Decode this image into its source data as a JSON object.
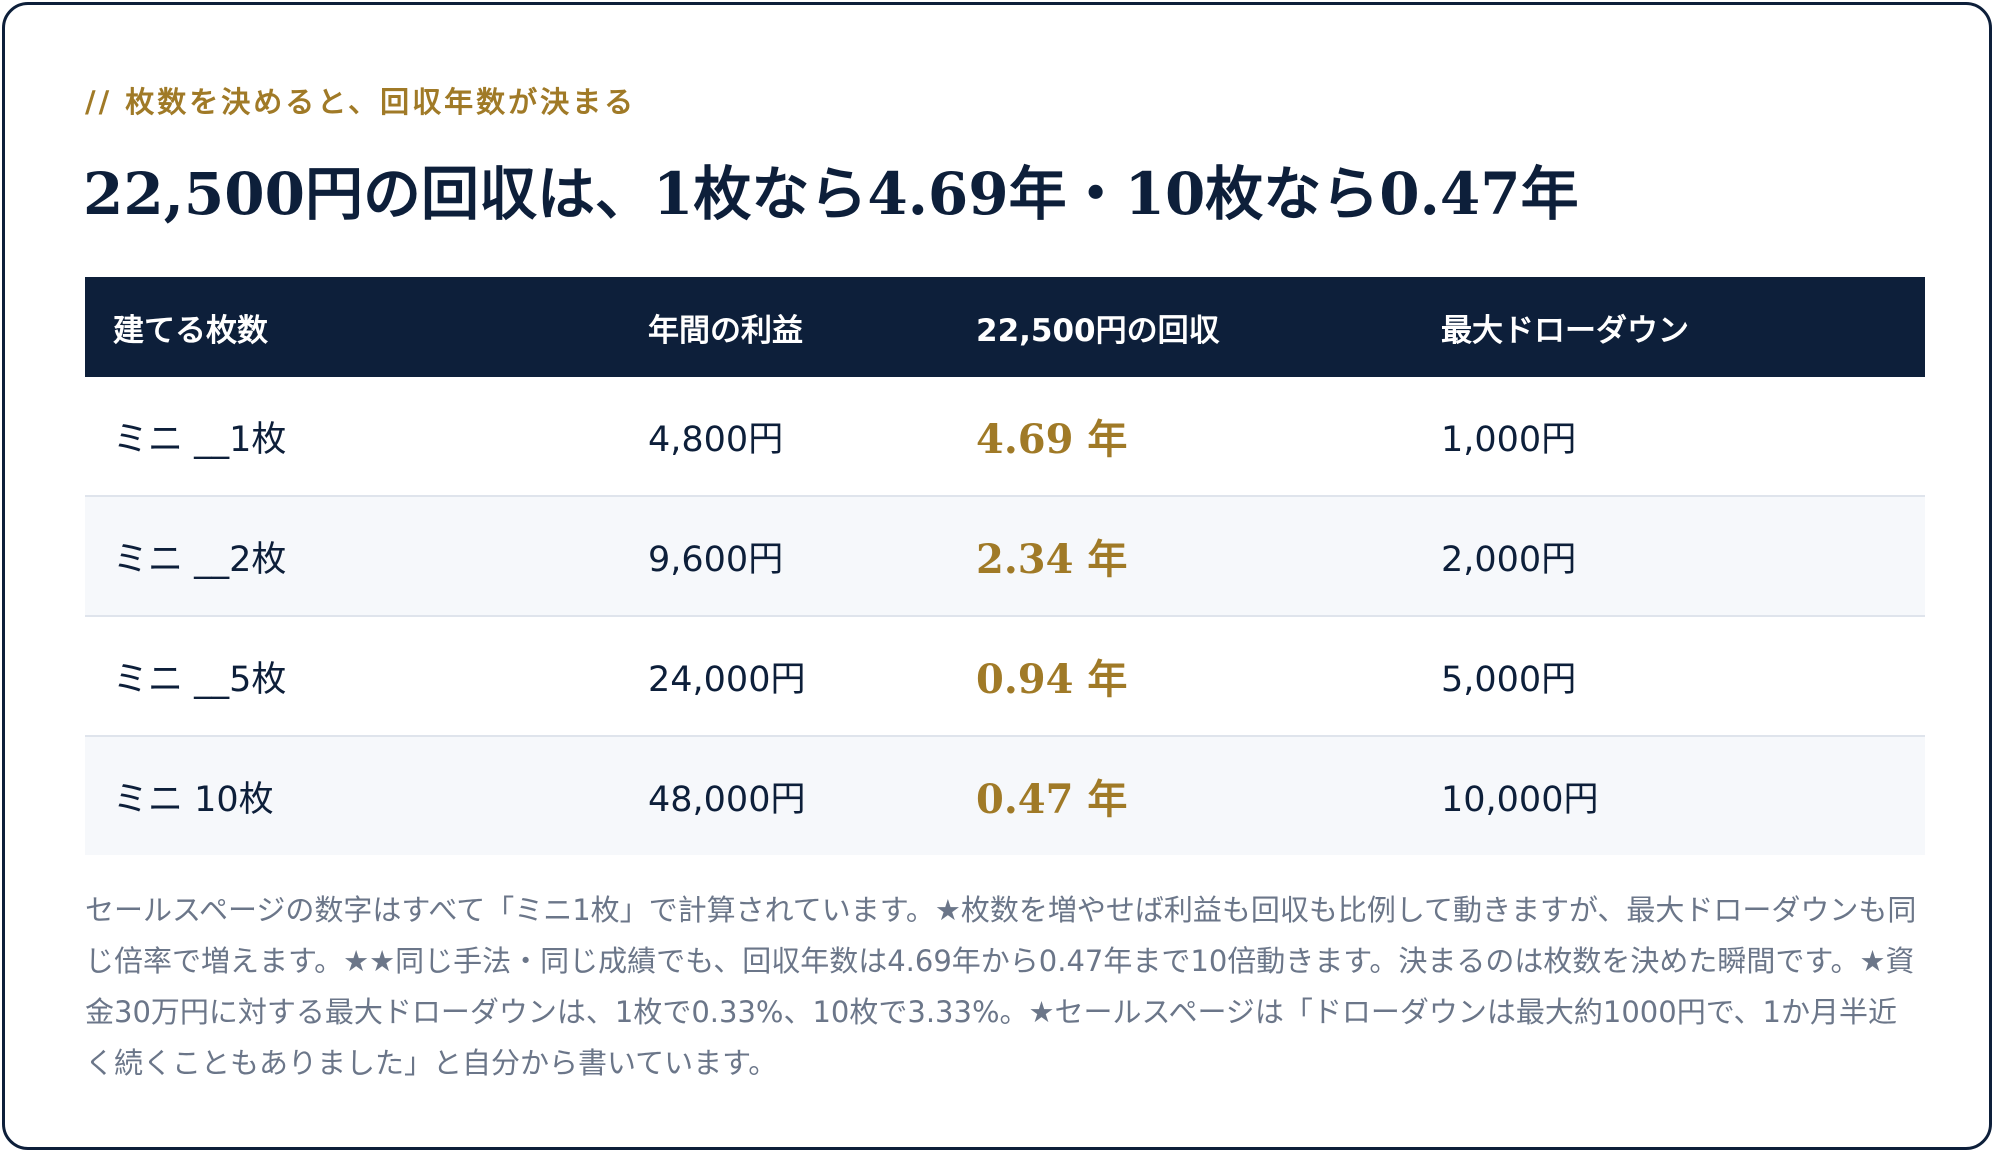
{
  "eyebrow": "// 枚数を決めると、回収年数が決まる",
  "title": "22,500円の回収は、1枚なら4.69年・10枚なら0.47年",
  "table": {
    "headers": [
      "建てる枚数",
      "年間の利益",
      "22,500円の回収",
      "最大ドローダウン"
    ],
    "rows": [
      {
        "lots": "ミニ __1枚",
        "profit": "4,800円",
        "payback": "4.69",
        "payback_unit": "年",
        "drawdown": "1,000円"
      },
      {
        "lots": "ミニ __2枚",
        "profit": "9,600円",
        "payback": "2.34",
        "payback_unit": "年",
        "drawdown": "2,000円"
      },
      {
        "lots": "ミニ __5枚",
        "profit": "24,000円",
        "payback": "0.94",
        "payback_unit": "年",
        "drawdown": "5,000円"
      },
      {
        "lots": "ミニ 10枚",
        "profit": "48,000円",
        "payback": "0.47",
        "payback_unit": "年",
        "drawdown": "10,000円"
      }
    ]
  },
  "note": "セールスページの数字はすべて「ミニ1枚」で計算されています。★枚数を増やせば利益も回収も比例して動きますが、最大ドローダウンも同じ倍率で増えます。★★同じ手法・同じ成績でも、回収年数は4.69年から0.47年まで10倍動きます。決まるのは枚数を決めた瞬間です。★資金30万円に対する最大ドローダウンは、1枚で0.33%、10枚で3.33%。★セールスページは「ドローダウンは最大約1000円で、1か月半近く続くこともありました」と自分から書いています。",
  "colors": {
    "navy": "#0d1f3a",
    "gold": "#a07a27",
    "muted": "#6b7689"
  }
}
